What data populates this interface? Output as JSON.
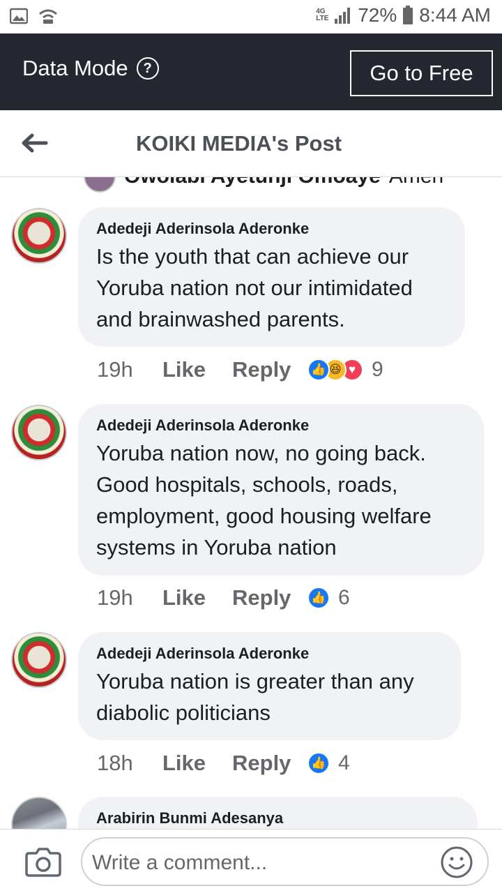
{
  "status_bar": {
    "signal_type": "4G LTE",
    "battery": "72%",
    "time": "8:44 AM"
  },
  "data_mode": {
    "title": "Data Mode",
    "help_icon": "?",
    "button_label": "Go to Free"
  },
  "header": {
    "title": "KOIKI MEDIA's Post"
  },
  "partial_comment": {
    "name": "Owolabi Ayetunji Omoaye",
    "text": "Amen"
  },
  "comments": [
    {
      "author": "Adedeji Aderinsola Aderonke",
      "text": "Is the youth that can achieve our Yoruba nation not our intimidated and brainwashed parents.",
      "time": "19h",
      "like_label": "Like",
      "reply_label": "Reply",
      "reactions": [
        "like",
        "haha",
        "love"
      ],
      "reaction_count": "9"
    },
    {
      "author": "Adedeji Aderinsola Aderonke",
      "text": "Yoruba nation now, no going back. Good hospitals, schools, roads, employment, good housing welfare systems in Yoruba nation",
      "time": "19h",
      "like_label": "Like",
      "reply_label": "Reply",
      "reactions": [
        "like"
      ],
      "reaction_count": "6"
    },
    {
      "author": "Adedeji Aderinsola Aderonke",
      "text": "Yoruba nation is greater than any diabolic politicians",
      "time": "18h",
      "like_label": "Like",
      "reply_label": "Reply",
      "reactions": [
        "like"
      ],
      "reaction_count": "4"
    },
    {
      "author": "Arabirin Bunmi Adesanya"
    }
  ],
  "composer": {
    "placeholder": "Write a comment..."
  },
  "colors": {
    "dark_bar": "#242730",
    "like_blue": "#1877f2",
    "bubble_bg": "#f0f2f5",
    "meta_gray": "#65676b"
  }
}
